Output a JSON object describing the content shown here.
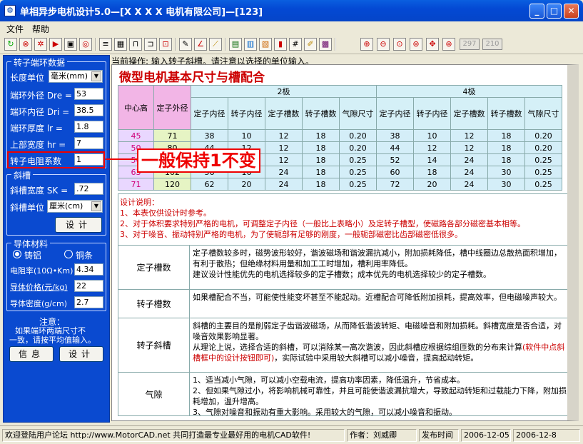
{
  "window": {
    "title": "单相异步电机设计5.0—[X X X X 电机有限公司]—[123]",
    "icon": "app-icon",
    "min": "_",
    "max": "□",
    "close": "✕"
  },
  "menu": [
    "文件",
    "帮助"
  ],
  "toolbar": {
    "field1": "297",
    "field2": "210"
  },
  "left": {
    "ring_group": "转子端环数据",
    "length_unit_label": "长度单位",
    "length_unit": "毫米(mm)",
    "dre_label": "端环外径 Dre =",
    "dre": "53",
    "dri_label": "端环内径 Dri =",
    "dri": "38.5",
    "lr_label": "端环厚度  lr =",
    "lr": "1.8",
    "hr_label": "上部宽度  hr =",
    "hr": "7",
    "coef_label": "转子电阻系数",
    "coef": "1",
    "skew_group": "斜槽",
    "sk_label": "斜槽宽度  SK =",
    "sk": ".72",
    "skew_unit_label": "斜槽单位",
    "skew_unit": "厘米(cm)",
    "design_btn": "设计",
    "material_group": "导体材料",
    "cast_al": "铸铝",
    "copper": "铜条",
    "resist_label": "电阻率(10Ω•Km)",
    "resist": "4.34",
    "price_label": "导体价格(元/kg)",
    "price": "22",
    "density_label": "导体密度(g/cm)",
    "density": "2.7",
    "note_title": "注意：",
    "note_1": "如果端环两端尺寸不",
    "note_2": "一致，请按平均值输入。",
    "info_btn": "信息",
    "design_btn2": "设计"
  },
  "op_text": "当前操作: 输入转子斜槽。请注意以选择的单位输入。",
  "page_title": "微型电机基本尺寸与槽配合",
  "annotation": "一般保持1不变",
  "table": {
    "h_center": "中心高",
    "h_stator_od": "定子外径",
    "h_2p": "2极",
    "h_4p": "4极",
    "cols": [
      "定子内径",
      "转子内径",
      "定子槽数",
      "转子槽数",
      "气隙尺寸",
      "定子内径",
      "转子内径",
      "定子槽数",
      "转子槽数",
      "气隙尺寸"
    ],
    "rows": [
      [
        "45",
        "71",
        "38",
        "10",
        "12",
        "18",
        "0.20",
        "38",
        "10",
        "12",
        "18",
        "0.20"
      ],
      [
        "50",
        "80",
        "44",
        "12",
        "12",
        "18",
        "0.20",
        "44",
        "12",
        "12",
        "18",
        "0.20"
      ],
      [
        "56",
        "90",
        "50",
        "14",
        "12",
        "18",
        "0.25",
        "52",
        "14",
        "24",
        "18",
        "0.25"
      ],
      [
        "63",
        "102",
        "56",
        "16",
        "24",
        "18",
        "0.25",
        "60",
        "18",
        "24",
        "30",
        "0.25"
      ],
      [
        "71",
        "120",
        "62",
        "20",
        "24",
        "18",
        "0.25",
        "72",
        "20",
        "24",
        "30",
        "0.25"
      ]
    ]
  },
  "notes": {
    "title": "设计说明：",
    "l1": "    1、本表仅供设计时参考。",
    "l2": "    2、对于体积要求特别严格的电机，可调整定子内径（一般比上表略小）及定转子槽型，使磁路各部分磁密基本相等。",
    "l3": "    3、对于噪音、振动特别严格的电机，为了使轭部有足够的刚度，一般轭部磁密比齿部磁密低很多。",
    "stator_label": "定子槽数",
    "stator_1": "       定子槽数较多时，磁势波形较好，谐波磁场和谐波漏抗减小，附加损耗降低，槽中线圈边总散热面积增加，有利于散热；但绝缘材料用量和加工工时增加，槽利用率降低。",
    "stator_2": "   建议设计性能优先的电机选择较多的定子槽数；成本优先的电机选择较少的定子槽数。",
    "rotor_label": "转子槽数",
    "rotor_1": "       如果槽配合不当，可能使性能变坏甚至不能起动。近槽配合可降低附加损耗，提高效率，但电磁噪声较大。",
    "skew_label": "转子斜槽",
    "skew_1": "       斜槽的主要目的是削弱定子齿谐波磁场，从而降低谐波转矩、电磁噪音和附加损耗。斜槽宽度是否合适，对噪音效果影响显著。",
    "skew_2": "       从理论上说，选择合适的斜槽，可以消除某一高次谐波，因此斜槽应根据综组匝数的分布来计算",
    "skew_3": "(软件中点斜槽框中的设计按钮即可)",
    "skew_4": "，实际试验中采用较大斜槽可以减小噪音，提高起动转矩。",
    "gap_label": "气隙",
    "gap_1": "       1、适当减小气隙，可以减小空载电流，提高功率因素，降低温升，节省成本。",
    "gap_2": "       2、但如果气隙过小，将影响机械可靠性，并且可能使谐波漏抗增大，导致起动转矩和过载能力下降，附加损耗增加，温升增高。",
    "gap_3": "       3、气隙对噪音和振动有重大影响。采用较大的气隙，可以减小噪音和振动。"
  },
  "status": {
    "s1": "欢迎登陆用户论坛 http://www.MotorCAD.net 共同打造最专业最好用的电机CAD软件!",
    "s2": "作者：刘威卿",
    "s3": "发布时间",
    "s4": "2006-12-05",
    "s5": "2006-12-8"
  }
}
